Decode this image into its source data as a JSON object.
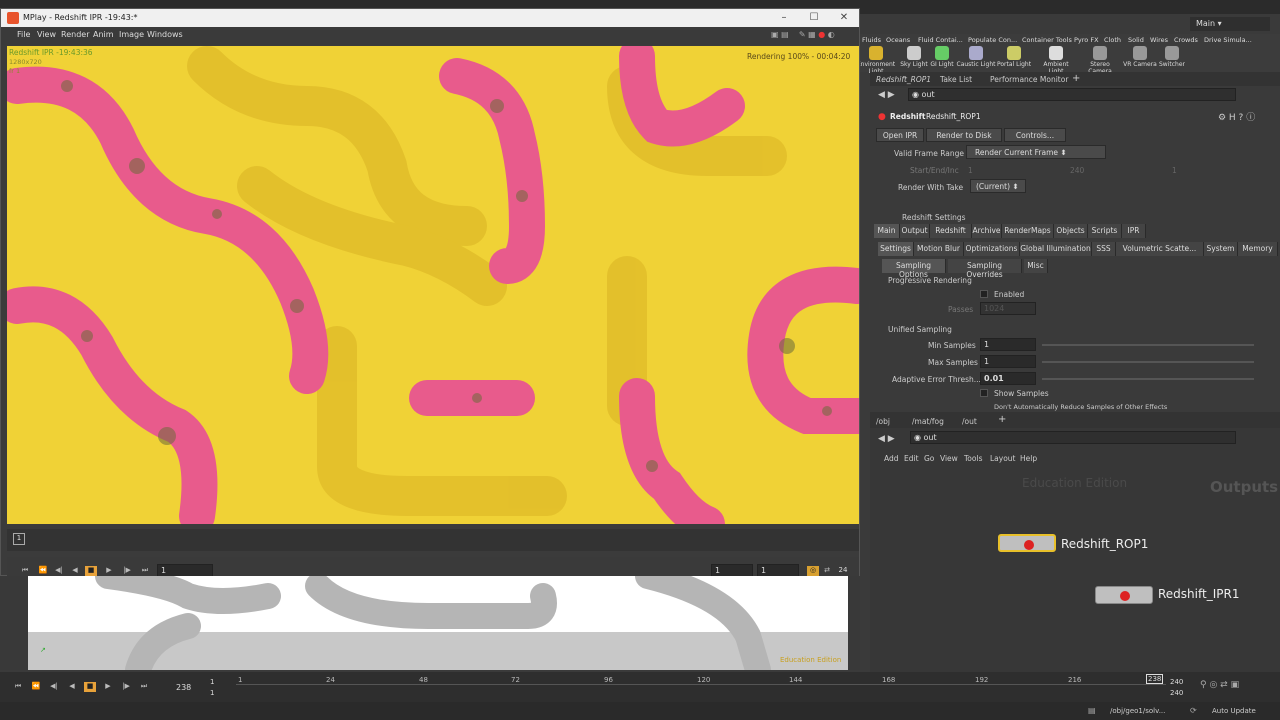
{
  "os": {
    "main_label": "Main"
  },
  "mplay": {
    "title": "MPlay - Redshift IPR -19:43:*",
    "menu": [
      "File",
      "View",
      "Render",
      "Anim",
      "Image",
      "Windows"
    ],
    "overlay_title": "Redshift IPR -19:43:36",
    "overlay_res": "1280x720",
    "overlay_fr": "fr 1",
    "rendering_status": "Rendering 100% - 00:04:20",
    "timeline_marker": "1",
    "frame_field": "1",
    "range_start": "1",
    "range_end": "1",
    "fps": "24"
  },
  "shelf": {
    "tabs": [
      "Fluids",
      "Oceans",
      "Fluid Contai...",
      "Populate Con...",
      "Container Tools",
      "Pyro FX",
      "Cloth",
      "Solid",
      "Wires",
      "Crowds",
      "Drive Simula..."
    ],
    "tools": [
      "Environment Light",
      "Sky Light",
      "GI Light",
      "Caustic Light",
      "Portal Light",
      "Ambient Light",
      "Stereo Camera",
      "VR Camera",
      "Switcher"
    ]
  },
  "params": {
    "tabs": [
      "Redshift_ROP1",
      "Take List",
      "Performance Monitor"
    ],
    "path": "out",
    "node_type": "Redshift",
    "node_name": "Redshift_ROP1",
    "buttons": [
      "Open IPR",
      "Render to Disk",
      "Controls..."
    ],
    "valid_frame_range_label": "Valid Frame Range",
    "valid_frame_range_value": "Render Current Frame",
    "start_end_label": "Start/End/Inc",
    "start_val": "1",
    "end_val": "240",
    "inc_val": "1",
    "render_take_label": "Render With Take",
    "render_take_value": "(Current)",
    "settings_label": "Redshift Settings",
    "main_tabs": [
      "Main",
      "Output",
      "Redshift",
      "Archive",
      "RenderMaps",
      "Objects",
      "Scripts",
      "IPR"
    ],
    "sub_tabs": [
      "Settings",
      "Motion Blur",
      "Optimizations",
      "Global Illumination",
      "SSS",
      "Volumetric Scatte...",
      "System",
      "Memory"
    ],
    "sampling_tabs": [
      "Sampling Options",
      "Sampling Overrides",
      "Misc"
    ],
    "progressive_label": "Progressive Rendering",
    "enabled_label": "Enabled",
    "passes_label": "Passes",
    "passes_value": "1024",
    "unified_label": "Unified Sampling",
    "min_samples_label": "Min Samples",
    "min_samples_value": "1",
    "max_samples_label": "Max Samples",
    "max_samples_value": "1",
    "adaptive_label": "Adaptive Error Thresh...",
    "adaptive_value": "0.01",
    "show_samples_label": "Show Samples",
    "dont_reduce_label": "Don't Automatically Reduce Samples of Other Effects"
  },
  "network": {
    "tabs": [
      "/obj",
      "/mat/fog",
      "/out"
    ],
    "path": "out",
    "menu": [
      "Add",
      "Edit",
      "Go",
      "View",
      "Tools",
      "Layout",
      "Help"
    ],
    "watermark": "Education Edition",
    "context_label": "Outputs",
    "nodes": [
      "Redshift_ROP1",
      "Redshift_IPR1"
    ]
  },
  "viewport": {
    "edu_label": "Education Edition"
  },
  "timeline": {
    "current_frame": "238",
    "start": "1",
    "start2": "1",
    "ticks": [
      "1",
      "24",
      "48",
      "72",
      "96",
      "120",
      "144",
      "168",
      "192",
      "216"
    ],
    "marker": "238",
    "end": "240",
    "end2": "240"
  },
  "status": {
    "path": "/obj/geo1/solv...",
    "update_mode": "Auto Update"
  }
}
